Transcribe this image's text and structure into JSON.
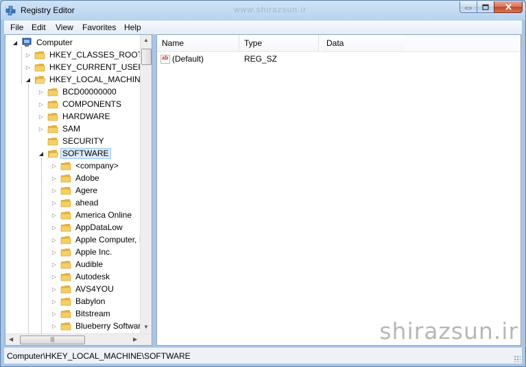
{
  "window": {
    "title": "Registry Editor",
    "title_watermark": "www.shirazsun.ir"
  },
  "menu": [
    "File",
    "Edit",
    "View",
    "Favorites",
    "Help"
  ],
  "tree": {
    "root": "Computer",
    "hives": [
      "HKEY_CLASSES_ROOT",
      "HKEY_CURRENT_USER",
      "HKEY_LOCAL_MACHINE"
    ],
    "hklm_children": [
      "BCD00000000",
      "COMPONENTS",
      "HARDWARE",
      "SAM",
      "SECURITY",
      "SOFTWARE"
    ],
    "software_children": [
      "<company>",
      "Adobe",
      "Agere",
      "ahead",
      "America Online",
      "AppDataLow",
      "Apple Computer, I",
      "Apple Inc.",
      "Audible",
      "Autodesk",
      "AVS4YOU",
      "Babylon",
      "Bitstream",
      "Blueberry Software"
    ]
  },
  "list": {
    "columns": [
      "Name",
      "Type",
      "Data"
    ],
    "rows": [
      {
        "name": "(Default)",
        "type": "REG_SZ",
        "data": "",
        "icon": "ab-string-icon"
      }
    ]
  },
  "watermark": "shirazsun.ir",
  "status": "Computer\\HKEY_LOCAL_MACHINE\\SOFTWARE",
  "colors": {
    "selection": "#dcebfc",
    "folder": "#f3c14b",
    "title_gradient": "#b9d3ee"
  }
}
